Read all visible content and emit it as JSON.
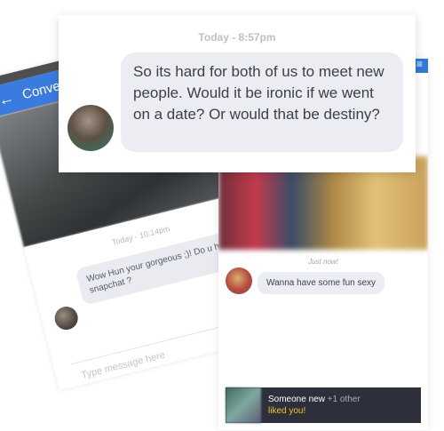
{
  "left_phone": {
    "appbar_title": "Conversa",
    "back_icon": "←",
    "timestamp": "Today - 10:14pm",
    "message": "Wow Hun your gorgeous ;)! Do u have snapchat ?",
    "input_placeholder": "Type message here"
  },
  "right_phone": {
    "menu_icon": "≡",
    "timestamp": "Just now!",
    "message": "Wanna have some fun sexy",
    "notification": {
      "name": "Someone new",
      "other": "+1 other",
      "action": "liked you!"
    }
  },
  "top_card": {
    "timestamp": "Today - 8:57pm",
    "message": "So its hard for both of us to meet new people. Would it be ironic if we went on a date? Or would that be destiny?"
  },
  "colors": {
    "accent": "#2f79d9",
    "bubble": "#ebedf2",
    "liked": "#f0c429"
  }
}
